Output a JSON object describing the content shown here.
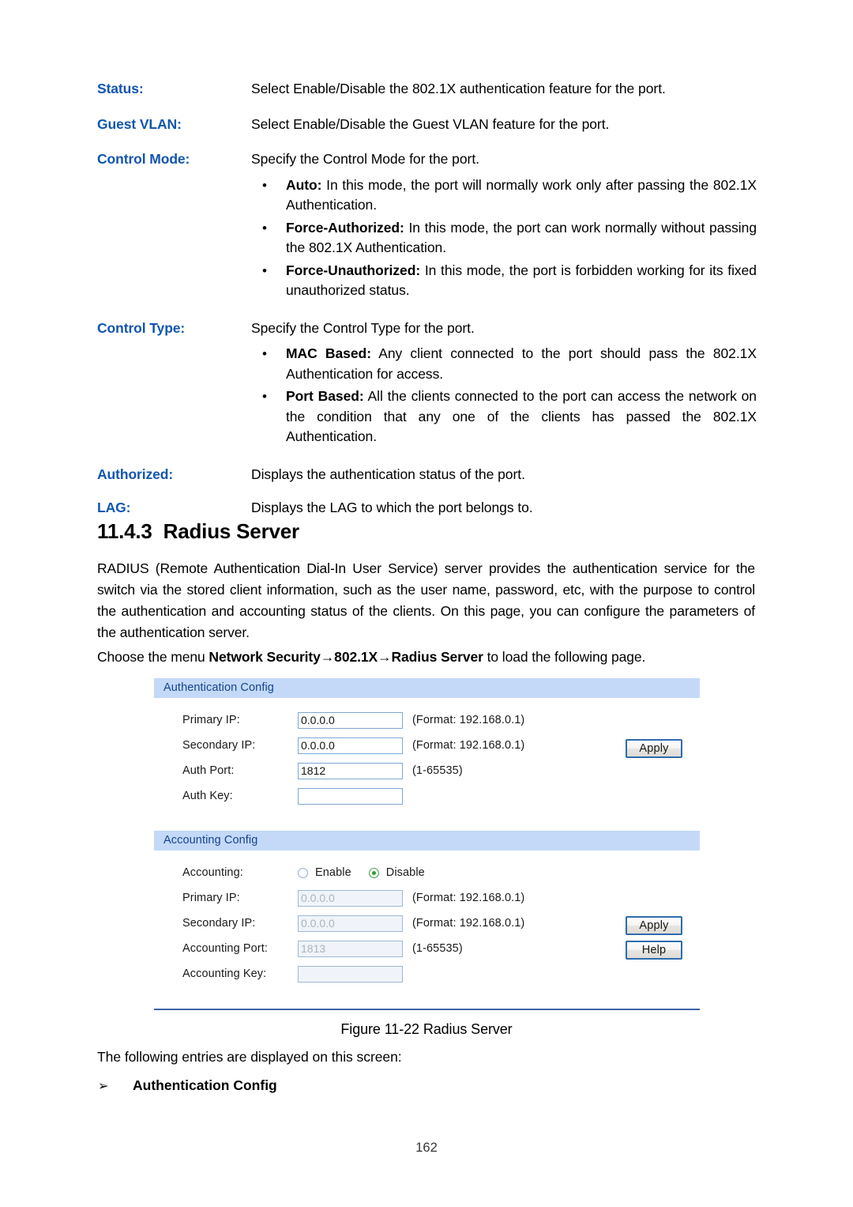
{
  "definitions": [
    {
      "label": "Status:",
      "lead": "Select Enable/Disable the 802.1X authentication feature for the port.",
      "bullets": []
    },
    {
      "label": "Guest VLAN:",
      "lead": "Select Enable/Disable the Guest VLAN feature for the port.",
      "bullets": []
    },
    {
      "label": "Control Mode:",
      "lead": "Specify the Control Mode for the port.",
      "bullets": [
        {
          "term": "Auto:",
          "text": " In this mode, the port will normally work only after passing the 802.1X Authentication."
        },
        {
          "term": "Force-Authorized:",
          "text": " In this mode, the port can work normally without passing the 802.1X Authentication."
        },
        {
          "term": "Force-Unauthorized:",
          "text": " In this mode, the port is forbidden working for its fixed unauthorized status."
        }
      ]
    },
    {
      "label": "Control Type:",
      "lead": "Specify the Control Type for the port.",
      "bullets": [
        {
          "term": "MAC Based:",
          "text": " Any client connected to the port should pass the 802.1X Authentication for access."
        },
        {
          "term": "Port Based:",
          "text": " All the clients connected to the port can access the network on the condition that any one of the clients has passed the 802.1X Authentication."
        }
      ]
    },
    {
      "label": "Authorized:",
      "lead": "Displays the authentication status of the port.",
      "bullets": []
    },
    {
      "label": "LAG:",
      "lead": "Displays the LAG to which the port belongs to.",
      "bullets": []
    }
  ],
  "heading": {
    "number": "11.4.3",
    "title": "Radius Server"
  },
  "paragraphs": {
    "intro": "RADIUS (Remote Authentication Dial-In User Service) server provides the authentication service for the switch via the stored client information, such as the user name, password, etc, with the purpose to control the authentication and accounting status of the clients. On this page, you can configure the parameters of the authentication server.",
    "menu_prefix": "Choose the menu ",
    "menu_path": "Network Security→802.1X→Radius Server",
    "menu_suffix": " to load the following page."
  },
  "ui": {
    "auth_panel": {
      "title": "Authentication Config",
      "rows": [
        {
          "label": "Primary IP:",
          "value": "0.0.0.0",
          "hint": "(Format: 192.168.0.1)",
          "disabled": false
        },
        {
          "label": "Secondary IP:",
          "value": "0.0.0.0",
          "hint": "(Format: 192.168.0.1)",
          "disabled": false
        },
        {
          "label": "Auth Port:",
          "value": "1812",
          "hint": "(1-65535)",
          "disabled": false
        },
        {
          "label": "Auth Key:",
          "value": "",
          "hint": "",
          "disabled": false
        }
      ],
      "buttons": [
        "Apply"
      ]
    },
    "acct_panel": {
      "title": "Accounting Config",
      "radio_row_label": "Accounting:",
      "radio_options": [
        {
          "label": "Enable",
          "selected": false
        },
        {
          "label": "Disable",
          "selected": true
        }
      ],
      "rows": [
        {
          "label": "Primary IP:",
          "value": "0.0.0.0",
          "hint": "(Format: 192.168.0.1)",
          "disabled": true
        },
        {
          "label": "Secondary IP:",
          "value": "0.0.0.0",
          "hint": "(Format: 192.168.0.1)",
          "disabled": true
        },
        {
          "label": "Accounting Port:",
          "value": "1813",
          "hint": "(1-65535)",
          "disabled": true
        },
        {
          "label": "Accounting Key:",
          "value": "",
          "hint": "",
          "disabled": true
        }
      ],
      "buttons": [
        "Apply",
        "Help"
      ]
    }
  },
  "figure_caption": "Figure 11-22 Radius Server",
  "after_figure_text": "The following entries are displayed on this screen:",
  "arrow_item": {
    "marker": "➢",
    "label": "Authentication Config"
  },
  "page_number": "162",
  "colors": {
    "label_blue": "#1156b0",
    "panel_header_bg": "#c3d9f7",
    "panel_header_text": "#17438f",
    "input_border": "#7fa8d4",
    "button_border": "#2f6cae",
    "radio_on": "#2f9e2f",
    "rule": "#3f62a8"
  }
}
